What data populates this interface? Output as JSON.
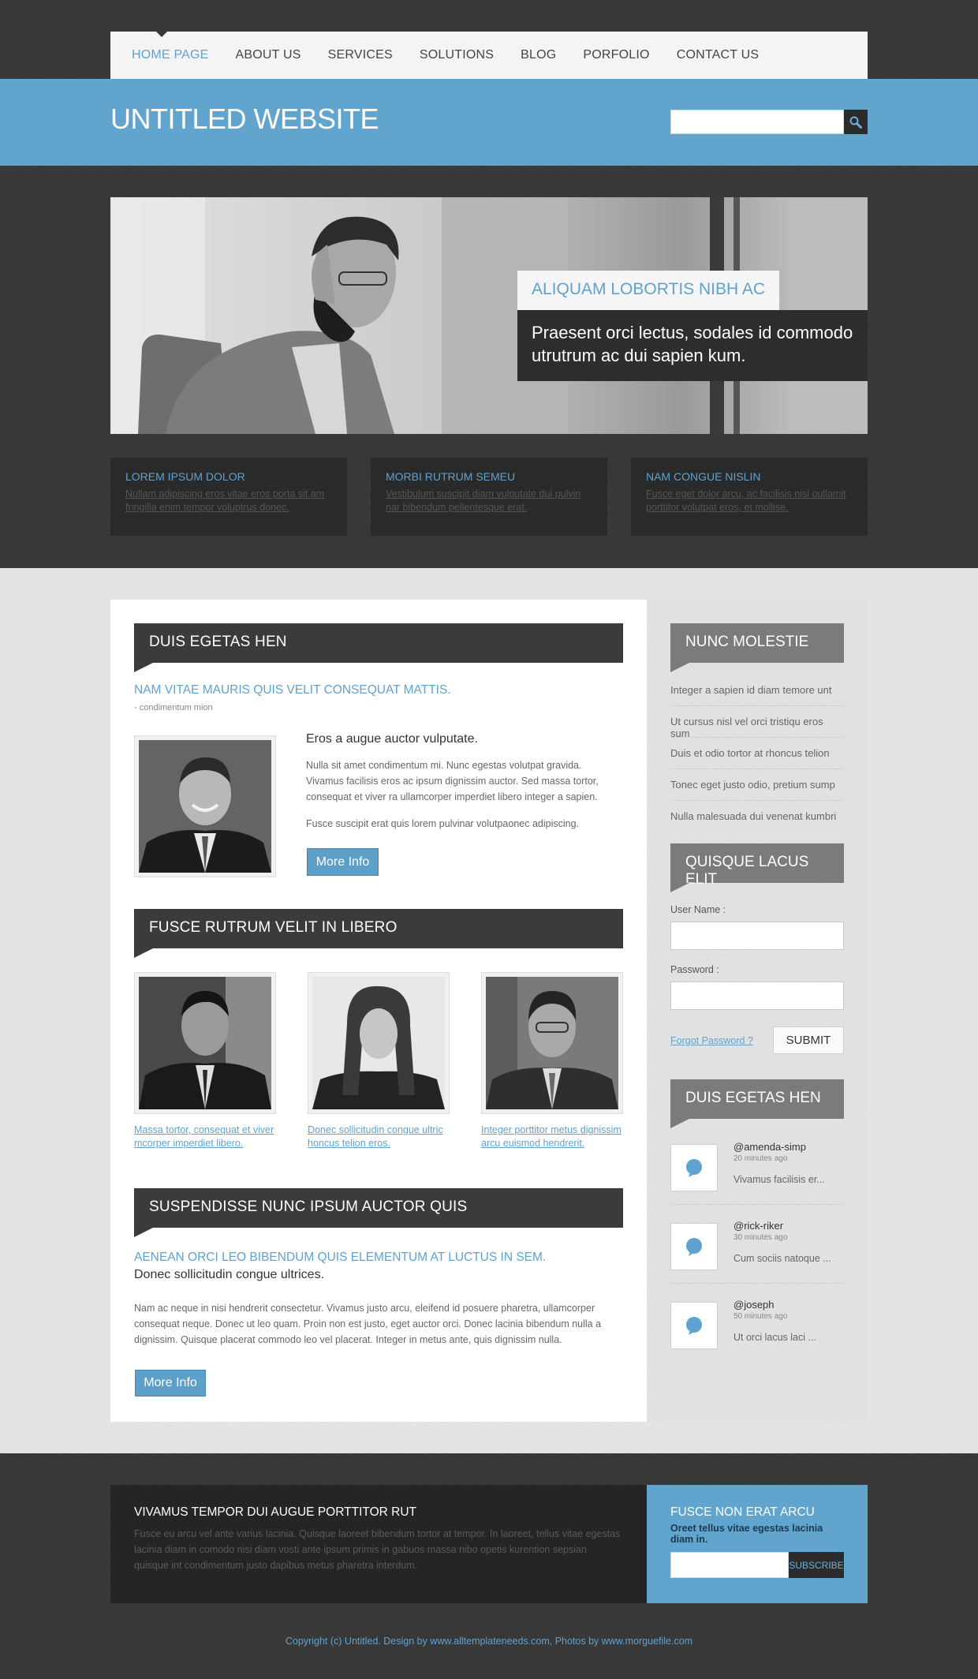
{
  "nav": {
    "items": [
      {
        "label": "HOME PAGE",
        "active": true
      },
      {
        "label": "ABOUT US"
      },
      {
        "label": "SERVICES"
      },
      {
        "label": "SOLUTIONS"
      },
      {
        "label": "BLOG"
      },
      {
        "label": "PORFOLIO"
      },
      {
        "label": "CONTACT US"
      }
    ]
  },
  "header": {
    "site_title": "UNTITLED WEBSITE",
    "search_placeholder": "",
    "search_icon": "search-icon"
  },
  "hero": {
    "caption_title": "ALIQUAM LOBORTIS NIBH AC",
    "caption_text": "Praesent orci lectus, sodales id commodo utrutrum ac dui sapien kum."
  },
  "features": [
    {
      "title": "LOREM IPSUM DOLOR",
      "text": "Nullam adipiscing eros vitae eros porta sit am fringilla enim tempor voluptrus donec."
    },
    {
      "title": "MORBI RUTRUM SEMEU",
      "text": "Vestibulum suscipit diam vulputate dui pulvin nar bibendum pellentesque erat."
    },
    {
      "title": "NAM CONGUE NISLIN",
      "text": "Fusce eget dolor arcu, ac facilisis nisi oullamit porttitor volutpat eros, et mollise."
    }
  ],
  "main": {
    "section1": {
      "heading": "DUIS EGETAS HEN",
      "subtitle": "NAM VITAE MAURIS QUIS VELIT CONSEQUAT MATTIS.",
      "meta": "- condimentum mion",
      "lead": "Eros a augue auctor vulputate.",
      "para1": "Nulla sit amet condimentum mi. Nunc egestas volutpat gravida. Vivamus facilisis eros ac ipsum dignissim auctor. Sed massa tortor, consequat et viver ra  ullamcorper imperdiet libero integer a sapien.",
      "para2": "Fusce suscipit erat quis lorem pulvinar volutpaonec adipiscing.",
      "button": "More Info"
    },
    "section2": {
      "heading": "FUSCE RUTRUM VELIT IN LIBERO",
      "items": [
        {
          "caption": "Massa tortor, consequat et viver mcorper imperdiet libero."
        },
        {
          "caption": "Donec sollicitudin congue ultric honcus telion eros."
        },
        {
          "caption": "Integer porttitor metus dignissim arcu euismod hendrerit."
        }
      ]
    },
    "section3": {
      "heading": "SUSPENDISSE NUNC IPSUM AUCTOR QUIS",
      "subtitle": "AENEAN ORCI LEO BIBENDUM QUIS ELEMENTUM AT LUCTUS IN SEM.",
      "lead": "Donec sollicitudin congue ultrices.",
      "para": "Nam ac neque in nisi hendrerit consectetur. Vivamus justo arcu, eleifend id posuere pharetra, ullamcorper consequat neque. Donec ut leo quam. Proin non est justo, eget auctor orci. Donec lacinia bibendum nulla a dignissim. Quisque placerat commodo leo vel placerat. Integer in metus ante, quis dignissim nulla.",
      "button": "More Info"
    }
  },
  "sidebar": {
    "list_heading": "NUNC MOLESTIE",
    "list_items": [
      "Integer a sapien id diam temore unt",
      "Ut cursus nisl vel orci tristiqu eros sum",
      "Duis et odio tortor at rhoncus telion",
      "Tonec eget justo odio, pretium sump",
      "Nulla malesuada dui venenat kumbri"
    ],
    "login_heading": "QUISQUE LACUS ELIT",
    "username_label": "User Name :",
    "password_label": "Password :",
    "forgot_label": "Forgot Password ?",
    "submit_label": "SUBMIT",
    "tweets_heading": "DUIS EGETAS HEN",
    "tweets": [
      {
        "user": "@amenda-simp",
        "time": "20 minutes ago",
        "text": "Vivamus facilisis er..."
      },
      {
        "user": "@rick-riker",
        "time": "30 minutes ago",
        "text": "Cum sociis natoque ..."
      },
      {
        "user": "@joseph",
        "time": "50 minutes ago",
        "text": "Ut orci lacus laci ..."
      }
    ]
  },
  "footer": {
    "left_heading": "VIVAMUS TEMPOR DUI  AUGUE PORTTITOR RUT",
    "left_text": "Fusce eu arcu vel ante varius lacinia. Quisque laoreet bibendum tortor at tempor. In laoreet, tellus vitae egestas lacinia diam in comodo nisi diam vosti ante ipsum primis in gabuos massa nibo opetis kurention sepsian quisque int condimentum justo dapibus metus pharetra interdum.",
    "right_heading": "FUSCE NON ERAT ARCU",
    "right_sub": "Oreet tellus vitae egestas lacinia diam in.",
    "subscribe_label": "SUBSCRIBE",
    "copyright": "Copyright (c) Untitled. Design by www.alltemplateneeds.com, Photos by www.morguefile.com"
  },
  "colors": {
    "accent": "#61a4cd",
    "link": "#5fa2cf",
    "dark": "#373737",
    "panel": "#2a2a2a"
  }
}
